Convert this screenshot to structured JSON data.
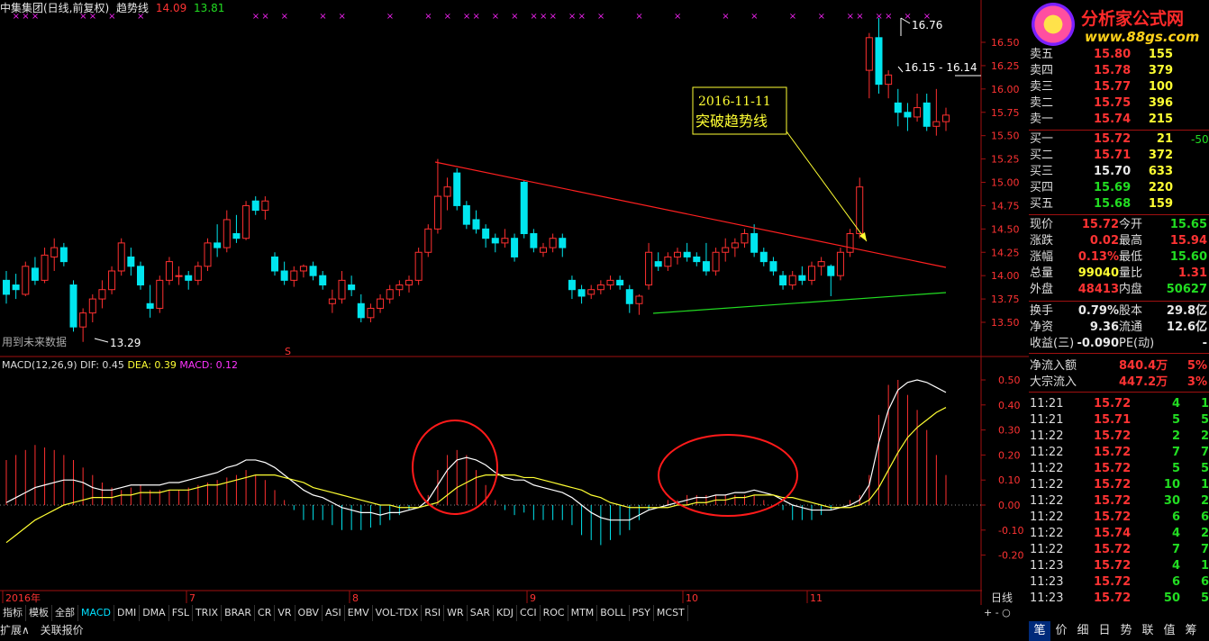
{
  "header": {
    "stock": "中集集团(日线,前复权)",
    "indicator": "趋势线",
    "v1": "14.09",
    "v2": "13.81"
  },
  "logo": {
    "name": "分析家公式网",
    "url": "www.88gs.com"
  },
  "price_axis": [
    "16.50",
    "16.25",
    "16.00",
    "15.75",
    "15.50",
    "15.25",
    "15.00",
    "14.75",
    "14.50",
    "14.25",
    "14.00",
    "13.75",
    "13.50"
  ],
  "macd_axis": [
    "0.50",
    "0.40",
    "0.30",
    "0.20",
    "0.10",
    "0.00",
    "-0.10",
    "-0.20"
  ],
  "annotations": {
    "high_label": "16.76",
    "range_label": "16.15 - 16.14",
    "low_label": "13.29",
    "future_data": "用到未来数据",
    "callout_date": "2016-11-11",
    "callout_text": "突破趋势线",
    "s_marker": "S"
  },
  "macd_header": {
    "name": "MACD(12,26,9)",
    "dif": "DIF: 0.45",
    "dea": "DEA: 0.39",
    "macd": "MACD: 0.12"
  },
  "date_axis": [
    "2016年",
    "7",
    "8",
    "9",
    "10",
    "11"
  ],
  "period_label": "日线",
  "tabs": [
    "指标",
    "模板",
    "全部",
    "MACD",
    "DMI",
    "DMA",
    "FSL",
    "TRIX",
    "BRAR",
    "CR",
    "VR",
    "OBV",
    "ASI",
    "EMV",
    "VOL-TDX",
    "RSI",
    "WR",
    "SAR",
    "KDJ",
    "CCI",
    "ROC",
    "MTM",
    "BOLL",
    "PSY",
    "MCST"
  ],
  "active_tab": "MACD",
  "bottom_tabs": [
    "扩展∧",
    "关联报价"
  ],
  "order_book": {
    "asks": [
      {
        "label": "卖五",
        "price": "15.80",
        "vol": "155"
      },
      {
        "label": "卖四",
        "price": "15.78",
        "vol": "379"
      },
      {
        "label": "卖三",
        "price": "15.77",
        "vol": "100"
      },
      {
        "label": "卖二",
        "price": "15.75",
        "vol": "396"
      },
      {
        "label": "卖一",
        "price": "15.74",
        "vol": "215"
      }
    ],
    "bids": [
      {
        "label": "买一",
        "price": "15.72",
        "vol": "21",
        "chg": "-50"
      },
      {
        "label": "买二",
        "price": "15.71",
        "vol": "372"
      },
      {
        "label": "买三",
        "price": "15.70",
        "vol": "633"
      },
      {
        "label": "买四",
        "price": "15.69",
        "vol": "220"
      },
      {
        "label": "买五",
        "price": "15.68",
        "vol": "159"
      }
    ]
  },
  "stats": [
    {
      "l1": "现价",
      "v1": "15.72",
      "l2": "今开",
      "v2": "15.65"
    },
    {
      "l1": "涨跌",
      "v1": "0.02",
      "l2": "最高",
      "v2": "15.94"
    },
    {
      "l1": "涨幅",
      "v1": "0.13%",
      "l2": "最低",
      "v2": "15.60"
    },
    {
      "l1": "总量",
      "v1": "99040",
      "l2": "量比",
      "v2": "1.31"
    },
    {
      "l1": "外盘",
      "v1": "48413",
      "l2": "内盘",
      "v2": "50627"
    }
  ],
  "stats2": [
    {
      "l1": "换手",
      "v1": "0.79%",
      "l2": "股本",
      "v2": "29.8亿"
    },
    {
      "l1": "净资",
      "v1": "9.36",
      "l2": "流通",
      "v2": "12.6亿"
    },
    {
      "l1": "收益(三)",
      "v1": "-0.090",
      "l2": "PE(动)",
      "v2": "-"
    }
  ],
  "flow": [
    {
      "l": "净流入额",
      "v": "840.4万",
      "p": "5%"
    },
    {
      "l": "大宗流入",
      "v": "447.2万",
      "p": "3%"
    }
  ],
  "ticks": [
    {
      "t": "11:21",
      "p": "15.72",
      "v": "4",
      "x": "1"
    },
    {
      "t": "11:21",
      "p": "15.71",
      "v": "5",
      "x": "5"
    },
    {
      "t": "11:22",
      "p": "15.72",
      "v": "2",
      "x": "2"
    },
    {
      "t": "11:22",
      "p": "15.72",
      "v": "7",
      "x": "7"
    },
    {
      "t": "11:22",
      "p": "15.72",
      "v": "5",
      "x": "5"
    },
    {
      "t": "11:22",
      "p": "15.72",
      "v": "10",
      "x": "1"
    },
    {
      "t": "11:22",
      "p": "15.72",
      "v": "30",
      "x": "2"
    },
    {
      "t": "11:22",
      "p": "15.72",
      "v": "6",
      "x": "6"
    },
    {
      "t": "11:22",
      "p": "15.74",
      "v": "4",
      "x": "2"
    },
    {
      "t": "11:22",
      "p": "15.72",
      "v": "7",
      "x": "7"
    },
    {
      "t": "11:23",
      "p": "15.72",
      "v": "4",
      "x": "1"
    },
    {
      "t": "11:23",
      "p": "15.72",
      "v": "6",
      "x": "6"
    },
    {
      "t": "11:23",
      "p": "15.72",
      "v": "50",
      "x": "5"
    }
  ],
  "right_tabs": [
    "笔",
    "价",
    "细",
    "日",
    "势",
    "联",
    "值",
    "筹"
  ],
  "candles": [
    [
      13.95,
      14.05,
      13.7,
      13.8
    ],
    [
      13.9,
      14.02,
      13.75,
      13.85
    ],
    [
      13.8,
      14.15,
      13.78,
      14.1
    ],
    [
      14.08,
      14.2,
      13.9,
      13.95
    ],
    [
      13.95,
      14.3,
      13.92,
      14.22
    ],
    [
      14.2,
      14.4,
      14.05,
      14.3
    ],
    [
      14.3,
      14.35,
      14.1,
      14.15
    ],
    [
      13.9,
      13.95,
      13.4,
      13.45
    ],
    [
      13.45,
      13.65,
      13.29,
      13.6
    ],
    [
      13.6,
      13.8,
      13.5,
      13.75
    ],
    [
      13.75,
      13.95,
      13.65,
      13.85
    ],
    [
      13.85,
      14.1,
      13.8,
      14.05
    ],
    [
      14.05,
      14.4,
      14.0,
      14.35
    ],
    [
      14.2,
      14.3,
      14.0,
      14.1
    ],
    [
      14.1,
      14.15,
      13.85,
      13.9
    ],
    [
      13.7,
      13.9,
      13.55,
      13.65
    ],
    [
      13.65,
      14.0,
      13.6,
      13.95
    ],
    [
      13.95,
      14.2,
      13.9,
      14.15
    ],
    [
      14.0,
      14.1,
      13.9,
      14.0
    ],
    [
      14.0,
      14.05,
      13.85,
      13.95
    ],
    [
      13.95,
      14.15,
      13.9,
      14.1
    ],
    [
      14.1,
      14.4,
      14.05,
      14.35
    ],
    [
      14.35,
      14.55,
      14.2,
      14.3
    ],
    [
      14.3,
      14.7,
      14.25,
      14.6
    ],
    [
      14.45,
      14.65,
      14.35,
      14.4
    ],
    [
      14.4,
      14.8,
      14.38,
      14.75
    ],
    [
      14.8,
      14.85,
      14.65,
      14.7
    ],
    [
      14.7,
      14.85,
      14.6,
      14.8
    ],
    [
      14.2,
      14.25,
      14.0,
      14.05
    ],
    [
      14.05,
      14.15,
      13.9,
      13.95
    ],
    [
      13.95,
      14.1,
      13.88,
      14.05
    ],
    [
      14.05,
      14.12,
      13.98,
      14.1
    ],
    [
      14.1,
      14.15,
      13.95,
      14.0
    ],
    [
      14.0,
      14.05,
      13.85,
      13.9
    ],
    [
      13.7,
      13.85,
      13.6,
      13.75
    ],
    [
      13.75,
      14.05,
      13.7,
      13.95
    ],
    [
      13.9,
      14.0,
      13.78,
      13.85
    ],
    [
      13.7,
      13.8,
      13.5,
      13.55
    ],
    [
      13.55,
      13.7,
      13.5,
      13.65
    ],
    [
      13.65,
      13.8,
      13.6,
      13.75
    ],
    [
      13.75,
      13.9,
      13.7,
      13.85
    ],
    [
      13.85,
      13.95,
      13.78,
      13.9
    ],
    [
      13.9,
      14.0,
      13.82,
      13.95
    ],
    [
      13.95,
      14.3,
      13.9,
      14.25
    ],
    [
      14.25,
      14.55,
      14.2,
      14.5
    ],
    [
      14.5,
      15.25,
      14.45,
      14.85
    ],
    [
      14.85,
      15.05,
      14.7,
      14.95
    ],
    [
      15.1,
      15.15,
      14.7,
      14.75
    ],
    [
      14.75,
      14.8,
      14.5,
      14.55
    ],
    [
      14.6,
      14.7,
      14.45,
      14.5
    ],
    [
      14.5,
      14.55,
      14.3,
      14.4
    ],
    [
      14.4,
      14.45,
      14.25,
      14.35
    ],
    [
      14.35,
      14.5,
      14.3,
      14.4
    ],
    [
      14.4,
      14.45,
      14.15,
      14.2
    ],
    [
      15.0,
      15.02,
      14.4,
      14.45
    ],
    [
      14.45,
      14.5,
      14.25,
      14.3
    ],
    [
      14.25,
      14.35,
      14.2,
      14.3
    ],
    [
      14.3,
      14.45,
      14.25,
      14.4
    ],
    [
      14.4,
      14.45,
      14.2,
      14.3
    ],
    [
      13.95,
      14.0,
      13.75,
      13.85
    ],
    [
      13.85,
      13.9,
      13.7,
      13.78
    ],
    [
      13.8,
      13.9,
      13.75,
      13.85
    ],
    [
      13.85,
      13.95,
      13.8,
      13.9
    ],
    [
      13.9,
      14.0,
      13.85,
      13.95
    ],
    [
      13.95,
      14.0,
      13.85,
      13.9
    ],
    [
      13.85,
      13.9,
      13.6,
      13.7
    ],
    [
      13.7,
      13.8,
      13.58,
      13.78
    ],
    [
      13.9,
      14.35,
      13.85,
      14.25
    ],
    [
      14.15,
      14.25,
      14.05,
      14.1
    ],
    [
      14.1,
      14.25,
      14.05,
      14.2
    ],
    [
      14.2,
      14.3,
      14.12,
      14.25
    ],
    [
      14.25,
      14.35,
      14.15,
      14.2
    ],
    [
      14.2,
      14.25,
      14.1,
      14.15
    ],
    [
      14.15,
      14.35,
      14.0,
      14.05
    ],
    [
      14.05,
      14.3,
      14.0,
      14.25
    ],
    [
      14.25,
      14.4,
      14.15,
      14.3
    ],
    [
      14.3,
      14.4,
      14.2,
      14.35
    ],
    [
      14.35,
      14.5,
      14.3,
      14.45
    ],
    [
      14.45,
      14.55,
      14.2,
      14.25
    ],
    [
      14.25,
      14.3,
      14.1,
      14.15
    ],
    [
      14.15,
      14.2,
      14.0,
      14.05
    ],
    [
      14.0,
      14.05,
      13.85,
      13.9
    ],
    [
      13.9,
      14.05,
      13.85,
      14.0
    ],
    [
      14.0,
      14.1,
      13.9,
      13.95
    ],
    [
      13.95,
      14.15,
      13.9,
      14.1
    ],
    [
      14.1,
      14.2,
      14.0,
      14.15
    ],
    [
      14.1,
      14.12,
      13.78,
      14.0
    ],
    [
      14.0,
      14.3,
      13.95,
      14.25
    ],
    [
      14.25,
      14.5,
      14.2,
      14.45
    ],
    [
      14.45,
      15.05,
      14.4,
      14.95
    ],
    [
      16.2,
      16.6,
      15.9,
      16.55
    ],
    [
      16.55,
      16.76,
      15.95,
      16.05
    ],
    [
      16.05,
      16.2,
      15.9,
      16.15
    ],
    [
      15.85,
      16.0,
      15.6,
      15.75
    ],
    [
      15.75,
      15.85,
      15.55,
      15.7
    ],
    [
      15.7,
      15.95,
      15.65,
      15.8
    ],
    [
      15.85,
      15.95,
      15.55,
      15.6
    ],
    [
      15.6,
      16.0,
      15.5,
      15.65
    ],
    [
      15.65,
      15.8,
      15.55,
      15.72
    ]
  ],
  "chart_data": {
    "type": "line",
    "title": "MACD(12,26,9)",
    "series": [
      {
        "name": "DIF",
        "values": [
          0.01,
          0.03,
          0.05,
          0.07,
          0.08,
          0.09,
          0.1,
          0.1,
          0.09,
          0.07,
          0.06,
          0.06,
          0.07,
          0.08,
          0.08,
          0.08,
          0.08,
          0.09,
          0.09,
          0.1,
          0.11,
          0.12,
          0.13,
          0.15,
          0.16,
          0.18,
          0.18,
          0.17,
          0.15,
          0.12,
          0.09,
          0.06,
          0.04,
          0.03,
          0.01,
          -0.01,
          -0.02,
          -0.03,
          -0.03,
          -0.04,
          -0.03,
          -0.03,
          -0.02,
          -0.01,
          0.02,
          0.08,
          0.14,
          0.18,
          0.19,
          0.18,
          0.16,
          0.13,
          0.11,
          0.1,
          0.1,
          0.08,
          0.07,
          0.06,
          0.05,
          0.03,
          0.0,
          -0.03,
          -0.05,
          -0.06,
          -0.06,
          -0.06,
          -0.04,
          -0.02,
          -0.01,
          0.0,
          0.01,
          0.02,
          0.03,
          0.03,
          0.04,
          0.04,
          0.05,
          0.05,
          0.06,
          0.05,
          0.04,
          0.02,
          0.0,
          -0.01,
          -0.02,
          -0.02,
          -0.02,
          -0.01,
          0.0,
          0.02,
          0.08,
          0.25,
          0.38,
          0.46,
          0.49,
          0.5,
          0.49,
          0.47,
          0.45
        ]
      },
      {
        "name": "DEA",
        "values": [
          -0.15,
          -0.12,
          -0.09,
          -0.06,
          -0.04,
          -0.02,
          0.0,
          0.01,
          0.02,
          0.03,
          0.03,
          0.03,
          0.04,
          0.04,
          0.05,
          0.05,
          0.05,
          0.06,
          0.06,
          0.06,
          0.07,
          0.08,
          0.08,
          0.09,
          0.1,
          0.11,
          0.12,
          0.12,
          0.12,
          0.11,
          0.1,
          0.09,
          0.07,
          0.06,
          0.05,
          0.04,
          0.03,
          0.02,
          0.01,
          0.0,
          0.0,
          -0.01,
          -0.01,
          -0.01,
          0.0,
          0.01,
          0.04,
          0.07,
          0.09,
          0.11,
          0.12,
          0.12,
          0.12,
          0.12,
          0.11,
          0.11,
          0.1,
          0.09,
          0.08,
          0.07,
          0.06,
          0.04,
          0.03,
          0.01,
          0.0,
          -0.01,
          -0.01,
          -0.01,
          -0.01,
          -0.01,
          0.0,
          0.0,
          0.01,
          0.01,
          0.02,
          0.02,
          0.03,
          0.03,
          0.04,
          0.04,
          0.04,
          0.03,
          0.03,
          0.02,
          0.01,
          0.0,
          -0.01,
          -0.01,
          -0.01,
          0.0,
          0.02,
          0.07,
          0.14,
          0.21,
          0.27,
          0.31,
          0.34,
          0.37,
          0.39
        ]
      },
      {
        "name": "MACD",
        "values": [
          0.18,
          0.2,
          0.22,
          0.24,
          0.23,
          0.22,
          0.2,
          0.18,
          0.15,
          0.12,
          0.09,
          0.07,
          0.06,
          0.07,
          0.08,
          0.06,
          0.06,
          0.06,
          0.06,
          0.07,
          0.08,
          0.09,
          0.1,
          0.11,
          0.12,
          0.14,
          0.12,
          0.1,
          0.06,
          0.02,
          -0.02,
          -0.06,
          -0.06,
          -0.06,
          -0.08,
          -0.1,
          -0.1,
          -0.1,
          -0.09,
          -0.08,
          -0.06,
          -0.04,
          -0.02,
          0.0,
          0.04,
          0.14,
          0.2,
          0.22,
          0.2,
          0.14,
          0.08,
          0.02,
          -0.02,
          -0.04,
          -0.03,
          -0.06,
          -0.06,
          -0.06,
          -0.06,
          -0.08,
          -0.12,
          -0.14,
          -0.16,
          -0.14,
          -0.12,
          -0.1,
          -0.06,
          -0.02,
          0.0,
          0.02,
          0.02,
          0.04,
          0.04,
          0.04,
          0.04,
          0.04,
          0.04,
          0.04,
          0.04,
          0.02,
          0.0,
          -0.02,
          -0.06,
          -0.06,
          -0.06,
          -0.04,
          -0.02,
          0.0,
          0.02,
          0.04,
          0.12,
          0.36,
          0.48,
          0.5,
          0.44,
          0.38,
          0.3,
          0.2,
          0.12
        ]
      }
    ],
    "ylim": [
      -0.25,
      0.55
    ],
    "price_ylim": [
      13.4,
      16.7
    ]
  }
}
